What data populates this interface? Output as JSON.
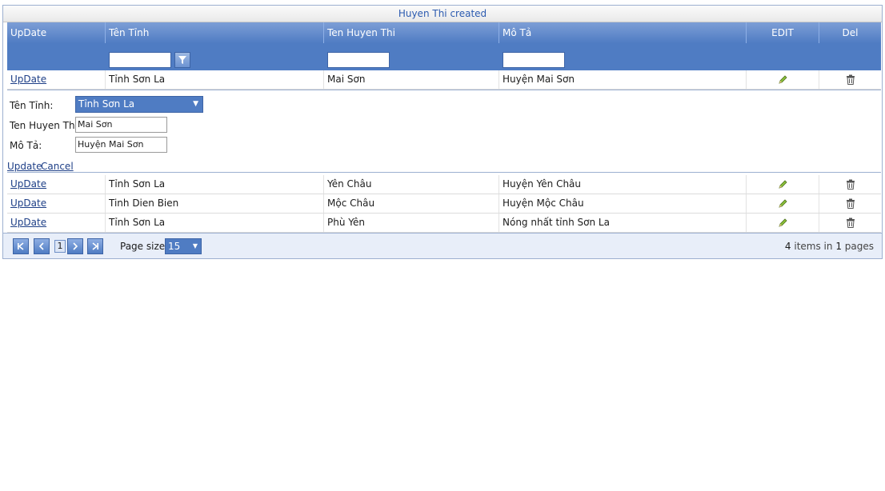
{
  "grid": {
    "caption": "Huyen Thi created",
    "headers": {
      "update": "UpDate",
      "ten_tinh": "Tên Tỉnh",
      "ten_huyen": "Ten Huyen Thi",
      "mo_ta": "Mô Tả",
      "edit": "EDIT",
      "del": "Del"
    },
    "rows": [
      {
        "update": "UpDate",
        "ten_tinh": "Tỉnh Sơn La",
        "ten_huyen": "Mai Sơn",
        "mo_ta": "Huyện Mai Sơn"
      },
      {
        "update": "UpDate",
        "ten_tinh": "Tỉnh Sơn La",
        "ten_huyen": "Yên Châu",
        "mo_ta": "Huyện Yên Châu"
      },
      {
        "update": "UpDate",
        "ten_tinh": "Tinh Dien Bien",
        "ten_huyen": "Mộc Châu",
        "mo_ta": "Huyện Mộc Châu"
      },
      {
        "update": "UpDate",
        "ten_tinh": "Tỉnh Sơn La",
        "ten_huyen": "Phù Yên",
        "mo_ta": "Nóng nhất tỉnh Sơn La"
      }
    ],
    "edit_icon": "pencil-icon",
    "delete_icon": "trash-icon"
  },
  "edit_form": {
    "ten_tinh_label": "Tên Tỉnh:",
    "ten_tinh_value": "Tỉnh Sơn La",
    "ten_huyen_label": "Ten Huyen Thi:",
    "ten_huyen_value": "Mai Sơn",
    "mo_ta_label": "Mô Tả:",
    "mo_ta_value": "Huyện Mai Sơn",
    "update_link": "Update",
    "cancel_link": "Cancel"
  },
  "pager": {
    "current_page": "1",
    "page_size_label": "Page size:",
    "page_size_value": "15",
    "summary_count": "4",
    "summary_mid": " items in ",
    "summary_pages": "1",
    "summary_tail": " pages"
  }
}
